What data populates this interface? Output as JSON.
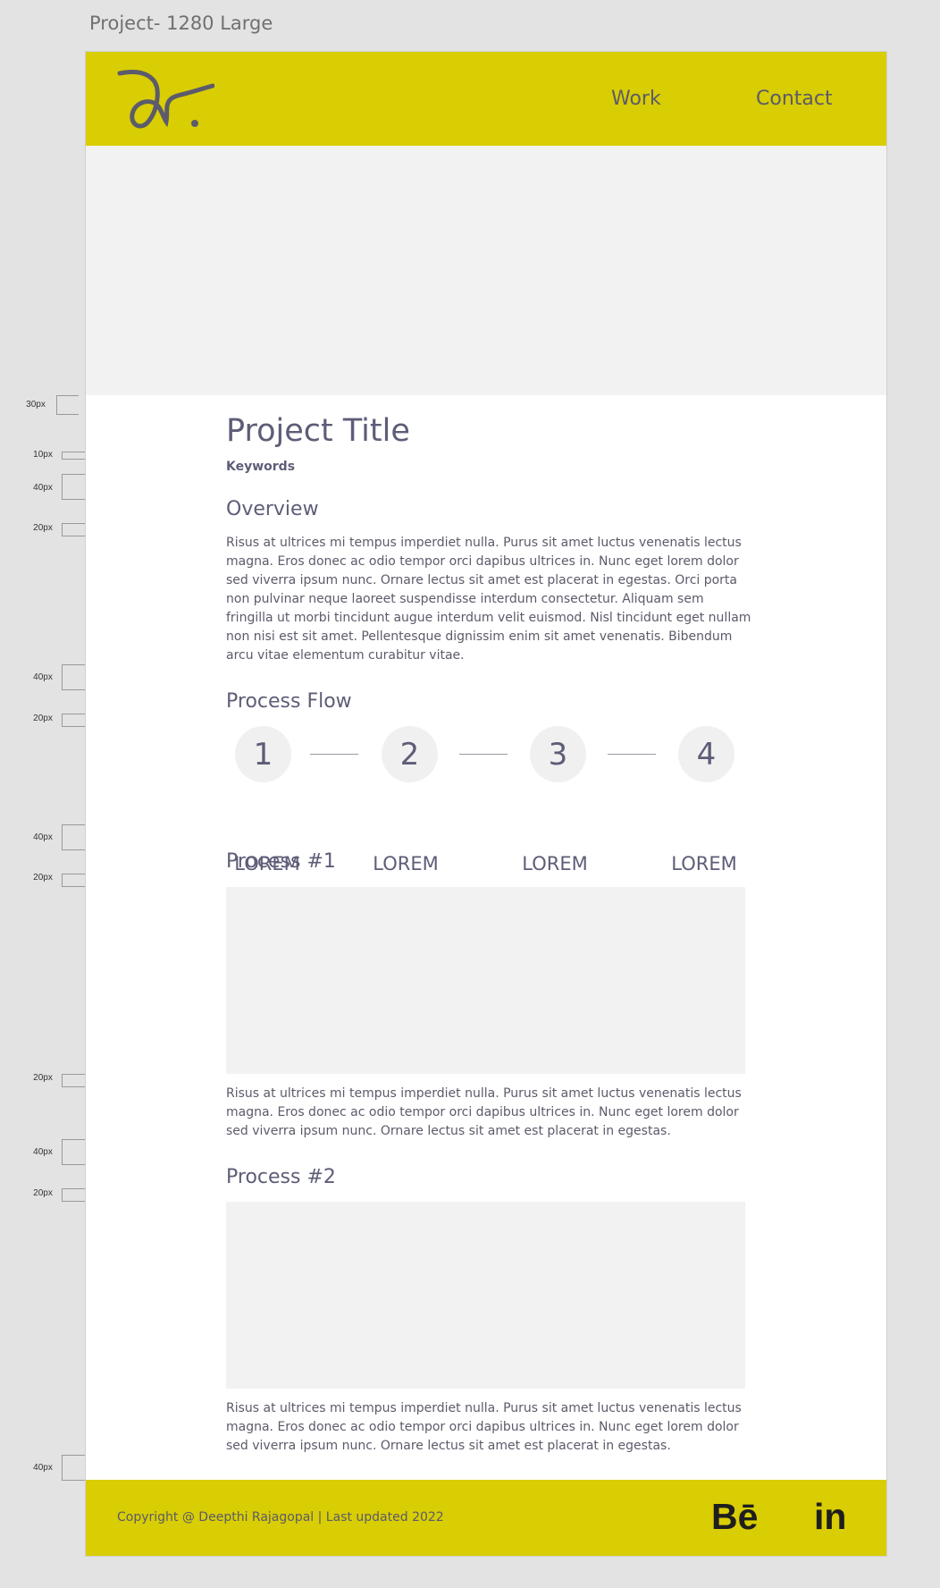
{
  "frame_label": "Project- 1280 Large",
  "nav": {
    "work": "Work",
    "contact": "Contact"
  },
  "project": {
    "title": "Project Title",
    "keywords": "Keywords"
  },
  "overview": {
    "heading": "Overview",
    "text": "Risus at ultrices mi tempus imperdiet nulla. Purus sit amet luctus venenatis lectus magna. Eros donec ac odio tempor orci dapibus ultrices in. Nunc eget lorem dolor sed viverra ipsum nunc. Ornare lectus sit amet est placerat in egestas. Orci porta non pulvinar neque laoreet suspendisse interdum consectetur. Aliquam sem fringilla ut morbi tincidunt augue interdum velit euismod. Nisl tincidunt eget nullam non nisi est sit amet. Pellentesque dignissim enim sit amet venenatis. Bibendum arcu vitae elementum curabitur vitae."
  },
  "process_flow": {
    "heading": "Process Flow",
    "steps": [
      {
        "number": "1",
        "label": "LOREM"
      },
      {
        "number": "2",
        "label": "LOREM"
      },
      {
        "number": "3",
        "label": "LOREM"
      },
      {
        "number": "4",
        "label": "LOREM"
      }
    ]
  },
  "process1": {
    "heading": "Process #1",
    "text": "Risus at ultrices mi tempus imperdiet nulla. Purus sit amet luctus venenatis lectus magna. Eros donec ac odio tempor orci dapibus ultrices in. Nunc eget lorem dolor sed viverra ipsum nunc. Ornare lectus sit amet est placerat in egestas."
  },
  "process2": {
    "heading": "Process #2",
    "text": "Risus at ultrices mi tempus imperdiet nulla. Purus sit amet luctus venenatis lectus magna. Eros donec ac odio tempor orci dapibus ultrices in. Nunc eget lorem dolor sed viverra ipsum nunc. Ornare lectus sit amet est placerat in egestas."
  },
  "footer": {
    "copyright": "Copyright @ Deepthi Rajagopal | Last updated 2022",
    "behance": "Bē",
    "linkedin": "in"
  },
  "spacing_annotations": [
    "30px",
    "10px",
    "40px",
    "20px",
    "40px",
    "20px",
    "40px",
    "20px",
    "20px",
    "40px",
    "20px",
    "40px"
  ],
  "colors": {
    "accent": "#d9cd03",
    "text": "#5d5d78",
    "placeholder": "#f2f2f2"
  }
}
